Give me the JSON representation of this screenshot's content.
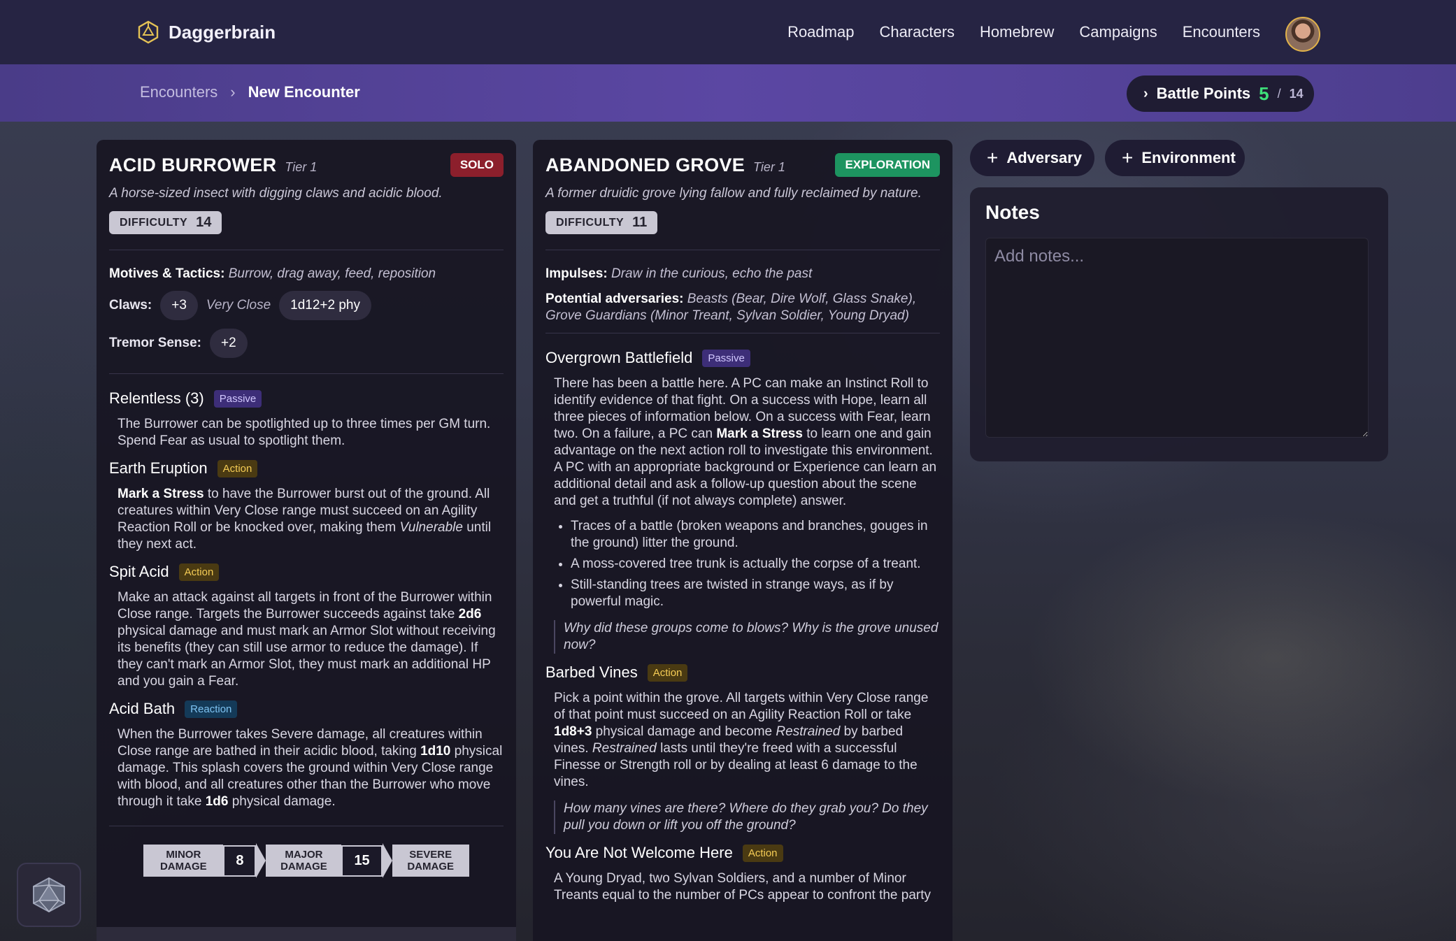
{
  "app": {
    "name": "Daggerbrain"
  },
  "nav": [
    "Roadmap",
    "Characters",
    "Homebrew",
    "Campaigns",
    "Encounters"
  ],
  "breadcrumb": {
    "parent": "Encounters",
    "current": "New Encounter"
  },
  "battle_points": {
    "label": "Battle Points",
    "current": "5",
    "max": "14"
  },
  "adversary": {
    "name": "ACID BURROWER",
    "tier": "Tier 1",
    "type": "SOLO",
    "description": "A horse-sized insect with digging claws and acidic blood.",
    "difficulty_label": "DIFFICULTY",
    "difficulty": "14",
    "motives_label": "Motives & Tactics:",
    "motives": "Burrow, drag away, feed, reposition",
    "attack_name": "Claws:",
    "attack_bonus": "+3",
    "attack_range": "Very Close",
    "attack_damage": "1d12+2 phy",
    "sense_label": "Tremor Sense:",
    "sense_value": "+2",
    "features": [
      {
        "name": "Relentless (3)",
        "kind": "Passive"
      },
      {
        "name": "Earth Eruption",
        "kind": "Action"
      },
      {
        "name": "Spit Acid",
        "kind": "Action"
      },
      {
        "name": "Acid Bath",
        "kind": "Reaction"
      }
    ],
    "f0_text": "The Burrower can be spotlighted up to three times per GM turn. Spend Fear as usual to spotlight them.",
    "f1_bold": "Mark a Stress",
    "f1_a": " to have the Burrower burst out of the ground. All creatures within Very Close range must succeed on an Agility Reaction Roll or be knocked over, making them ",
    "f1_italic": "Vulnerable",
    "f1_b": " until they next act.",
    "f2_a": "Make an attack against all targets in front of the Burrower within Close range. Targets the Burrower succeeds against take ",
    "f2_bold": "2d6",
    "f2_b": " physical damage and must mark an Armor Slot without receiving its benefits (they can still use armor to reduce the damage). If they can't mark an Armor Slot, they must mark an additional HP and you gain a Fear.",
    "f3_a": "When the Burrower takes Severe damage, all creatures within Close range are bathed in their acidic blood, taking ",
    "f3_bold1": "1d10",
    "f3_b": " physical damage. This splash covers the ground within Very Close range with blood, and all creatures other than the Burrower who move through it take ",
    "f3_bold2": "1d6",
    "f3_c": " physical damage.",
    "thresholds": {
      "minor": "MINOR DAMAGE",
      "major_value": "8",
      "major": "MAJOR DAMAGE",
      "severe_value": "15",
      "severe": "SEVERE DAMAGE"
    }
  },
  "environment": {
    "name": "ABANDONED GROVE",
    "tier": "Tier 1",
    "type": "EXPLORATION",
    "description": "A former druidic grove lying fallow and fully reclaimed by nature.",
    "difficulty_label": "DIFFICULTY",
    "difficulty": "11",
    "impulses_label": "Impulses:",
    "impulses": "Draw in the curious, echo the past",
    "adversaries_label": "Potential adversaries:",
    "adversaries": "Beasts (Bear, Dire Wolf, Glass Snake), Grove Guardians (Minor Treant, Sylvan Soldier, Young Dryad)",
    "features": [
      {
        "name": "Overgrown Battlefield",
        "kind": "Passive"
      },
      {
        "name": "Barbed Vines",
        "kind": "Action"
      },
      {
        "name": "You Are Not Welcome Here",
        "kind": "Action"
      }
    ],
    "f0_a": "There has been a battle here. A PC can make an Instinct Roll to identify evidence of that fight. On a success with Hope, learn all three pieces of information below. On a success with Fear, learn two. On a failure, a PC can ",
    "f0_bold": "Mark a Stress",
    "f0_b": " to learn one and gain advantage on the next action roll to investigate this environment. A PC with an appropriate background or Experience can learn an additional detail and ask a follow-up question about the scene and get a truthful (if not always complete) answer.",
    "f0_list": [
      "Traces of a battle (broken weapons and branches, gouges in the ground) litter the ground.",
      "A moss-covered tree trunk is actually the corpse of a treant.",
      "Still-standing trees are twisted in strange ways, as if by powerful magic."
    ],
    "f0_question": "Why did these groups come to blows? Why is the grove unused now?",
    "f1_a": "Pick a point within the grove. All targets within Very Close range of that point must succeed on an Agility Reaction Roll or take ",
    "f1_bold": "1d8+3",
    "f1_b": " physical damage and become ",
    "f1_italic1": "Restrained",
    "f1_c": " by barbed vines. ",
    "f1_italic2": "Restrained",
    "f1_d": " lasts until they're freed with a successful Finesse or Strength roll or by dealing at least 6 damage to the vines.",
    "f1_question": "How many vines are there? Where do they grab you? Do they pull you down or lift you off the ground?",
    "f2_text": "A Young Dryad, two Sylvan Soldiers, and a number of Minor Treants equal to the number of PCs appear to confront the party"
  },
  "actions": {
    "add_adversary": "Adversary",
    "add_environment": "Environment"
  },
  "notes": {
    "title": "Notes",
    "placeholder": "Add notes..."
  },
  "icons": {
    "brand": "d20-hex-icon",
    "plus": "plus-icon",
    "chevron": "chevron-right-icon",
    "dice": "d20-dice-icon"
  }
}
